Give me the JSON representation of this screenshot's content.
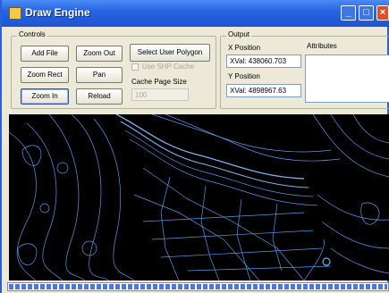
{
  "window": {
    "title": "Draw Engine",
    "icon": "app-icon"
  },
  "title_buttons": {
    "minimize": "_",
    "maximize": "□",
    "close": "×"
  },
  "controls": {
    "group_label": "Controls",
    "add_file": "Add File",
    "zoom_out": "Zoom Out",
    "select_user_polygon": "Select User Polygon",
    "zoom_rect": "Zoom Rect",
    "pan": "Pan",
    "use_shp_cache": "Use SHP Cache",
    "zoom_in": "Zoom In",
    "reload": "Reload",
    "cache_page_size_label": "Cache Page Size",
    "cache_page_size_value": "100"
  },
  "output": {
    "group_label": "Output",
    "x_label": "X Position",
    "x_value": "XVal: 438060.703",
    "y_label": "Y Position",
    "y_value": "XVal: 4898967.63",
    "attributes_label": "Attributes",
    "attributes_value": ""
  },
  "map": {
    "description_name": "contour-map-canvas",
    "line_color": "#7fb4ff",
    "background": "#000000"
  },
  "status": {
    "progress": 1.0
  }
}
